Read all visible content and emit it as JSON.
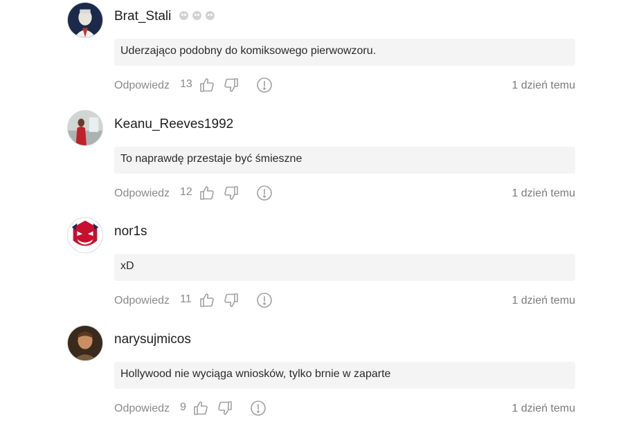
{
  "comments": [
    {
      "username": "Brat_Stali",
      "badges": [
        "badge-icon",
        "badge-icon",
        "badge-icon"
      ],
      "text": "Uderzająco podobny do komiksowego pierwowzoru.",
      "reply_label": "Odpowiedz",
      "votes": "13",
      "time": "1 dzień temu",
      "avatar_icon": "avatar-photo-icon"
    },
    {
      "username": "Keanu_Reeves1992",
      "text": "To naprawdę przestaje być śmieszne",
      "reply_label": "Odpowiedz",
      "votes": "12",
      "time": "1 dzień temu",
      "avatar_icon": "avatar-photo-icon"
    },
    {
      "username": "nor1s",
      "text": "xD",
      "reply_label": "Odpowiedz",
      "votes": "11",
      "time": "1 dzień temu",
      "avatar_icon": "avatar-mascot-icon"
    },
    {
      "username": "narysujmicos",
      "text": "Hollywood nie wyciąga wniosków, tylko brnie w zaparte",
      "reply_label": "Odpowiedz",
      "votes": "9",
      "time": "1 dzień temu",
      "avatar_icon": "avatar-photo-icon"
    }
  ],
  "colors": {
    "bubble_bg": "#f4f4f4",
    "muted_text": "#8a8a8a",
    "icon_gray": "#a0a0a0"
  }
}
